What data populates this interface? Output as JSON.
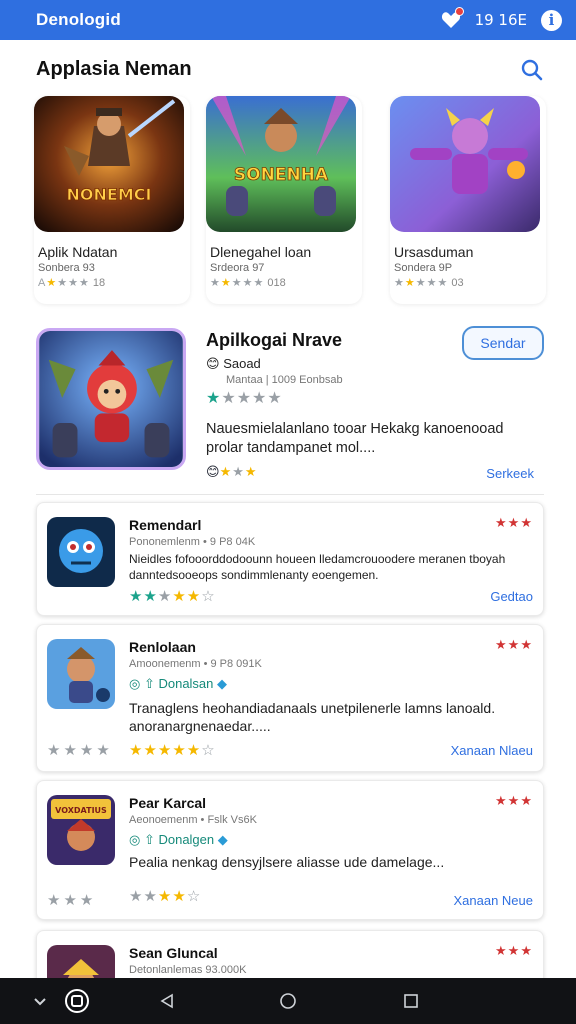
{
  "status_bar": {
    "app_name": "Denologid",
    "time": "19 16E",
    "info_glyph": "i"
  },
  "header": {
    "title": "Applasia Neman",
    "search_icon": "search-icon"
  },
  "featured": [
    {
      "name": "Aplik Ndatan",
      "sub": "Sonbera 93",
      "rating": "18",
      "art_text": "NONEMCI"
    },
    {
      "name": "Dlenegahel loan",
      "sub": "Srdeora 97",
      "rating": "018",
      "art_text": "SONENHA"
    },
    {
      "name": "Ursasduman",
      "sub": "Sondera 9P",
      "rating": "03",
      "art_text": ""
    }
  ],
  "hero": {
    "title": "Apilkogai Nrave",
    "button": "Sendar",
    "tag": "Saoad",
    "meta": "Mantaa | 1009 Eonbsab",
    "description": "Nauesmielalanlano tooar Hekakg kanoenooad prolar tandampanet mol....",
    "link": "Serkeek"
  },
  "cards": [
    {
      "title": "Remendarl",
      "meta": "Pononemlenm • 9 P8 04K",
      "description": "Nieidles fofooorddodoounn houeen lledamcrouoodere meranen tboyah danntedsooeops sondimmlenanty eoengemen.",
      "link": "Gedtao"
    },
    {
      "title": "Renlolaan",
      "meta": "Amoonemenm • 9 P8 091K",
      "badge": "Donalsan",
      "description": "Tranaglens heohandiadanaals unetpilenerle lamns lanoald. anoranargnenaedar.....",
      "link": "Xanaan Nlaeu"
    },
    {
      "title": "Pear Karcal",
      "meta": "Aeonoemenm • Fslk Vs6K",
      "badge": "Donalgen",
      "description": "Pealia nenkag densyjlsere aliasse ude damelage...",
      "link": "Xanaan Neue",
      "art_text": "VOXDATIUS"
    },
    {
      "title": "Sean Gluncal",
      "meta": "Detonlanlemas 93.000K"
    }
  ],
  "colors": {
    "accent": "#2f6fe0",
    "star_gold": "#f5b800",
    "star_teal": "#1ca38c",
    "star_red": "#d13434"
  }
}
